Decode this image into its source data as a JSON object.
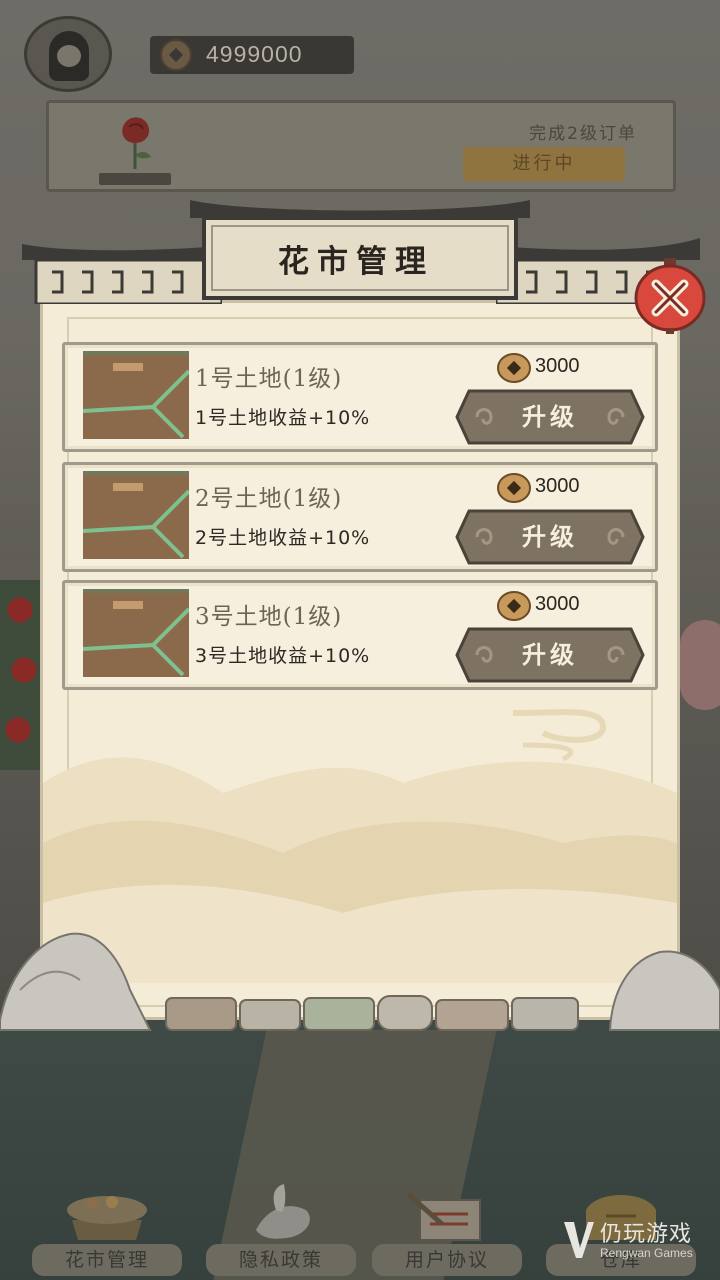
{
  "hud": {
    "coins": "4999000"
  },
  "order": {
    "task": "完成2级订单",
    "status": "进行中"
  },
  "dialog": {
    "title": "花市管理",
    "rows": [
      {
        "name": "1号土地(1级)",
        "desc": "1号土地收益+10%",
        "cost": "3000",
        "button": "升级"
      },
      {
        "name": "2号土地(1级)",
        "desc": "2号土地收益+10%",
        "cost": "3000",
        "button": "升级"
      },
      {
        "name": "3号土地(1级)",
        "desc": "3号土地收益+10%",
        "cost": "3000",
        "button": "升级"
      }
    ]
  },
  "nav": {
    "items": [
      {
        "label": "花市管理",
        "icon": "flower-cart-icon"
      },
      {
        "label": "隐私政策",
        "icon": "dove-icon"
      },
      {
        "label": "用户协议",
        "icon": "scroll-brush-icon"
      },
      {
        "label": "仓库",
        "icon": "warehouse-icon"
      }
    ]
  },
  "watermark": {
    "cn": "仍玩游戏",
    "en": "Rengwan Games"
  },
  "colors": {
    "parchment": "#f4ecd7",
    "button": "#7e7262",
    "close_red": "#d9483c",
    "overlay": "#5b5a52"
  }
}
